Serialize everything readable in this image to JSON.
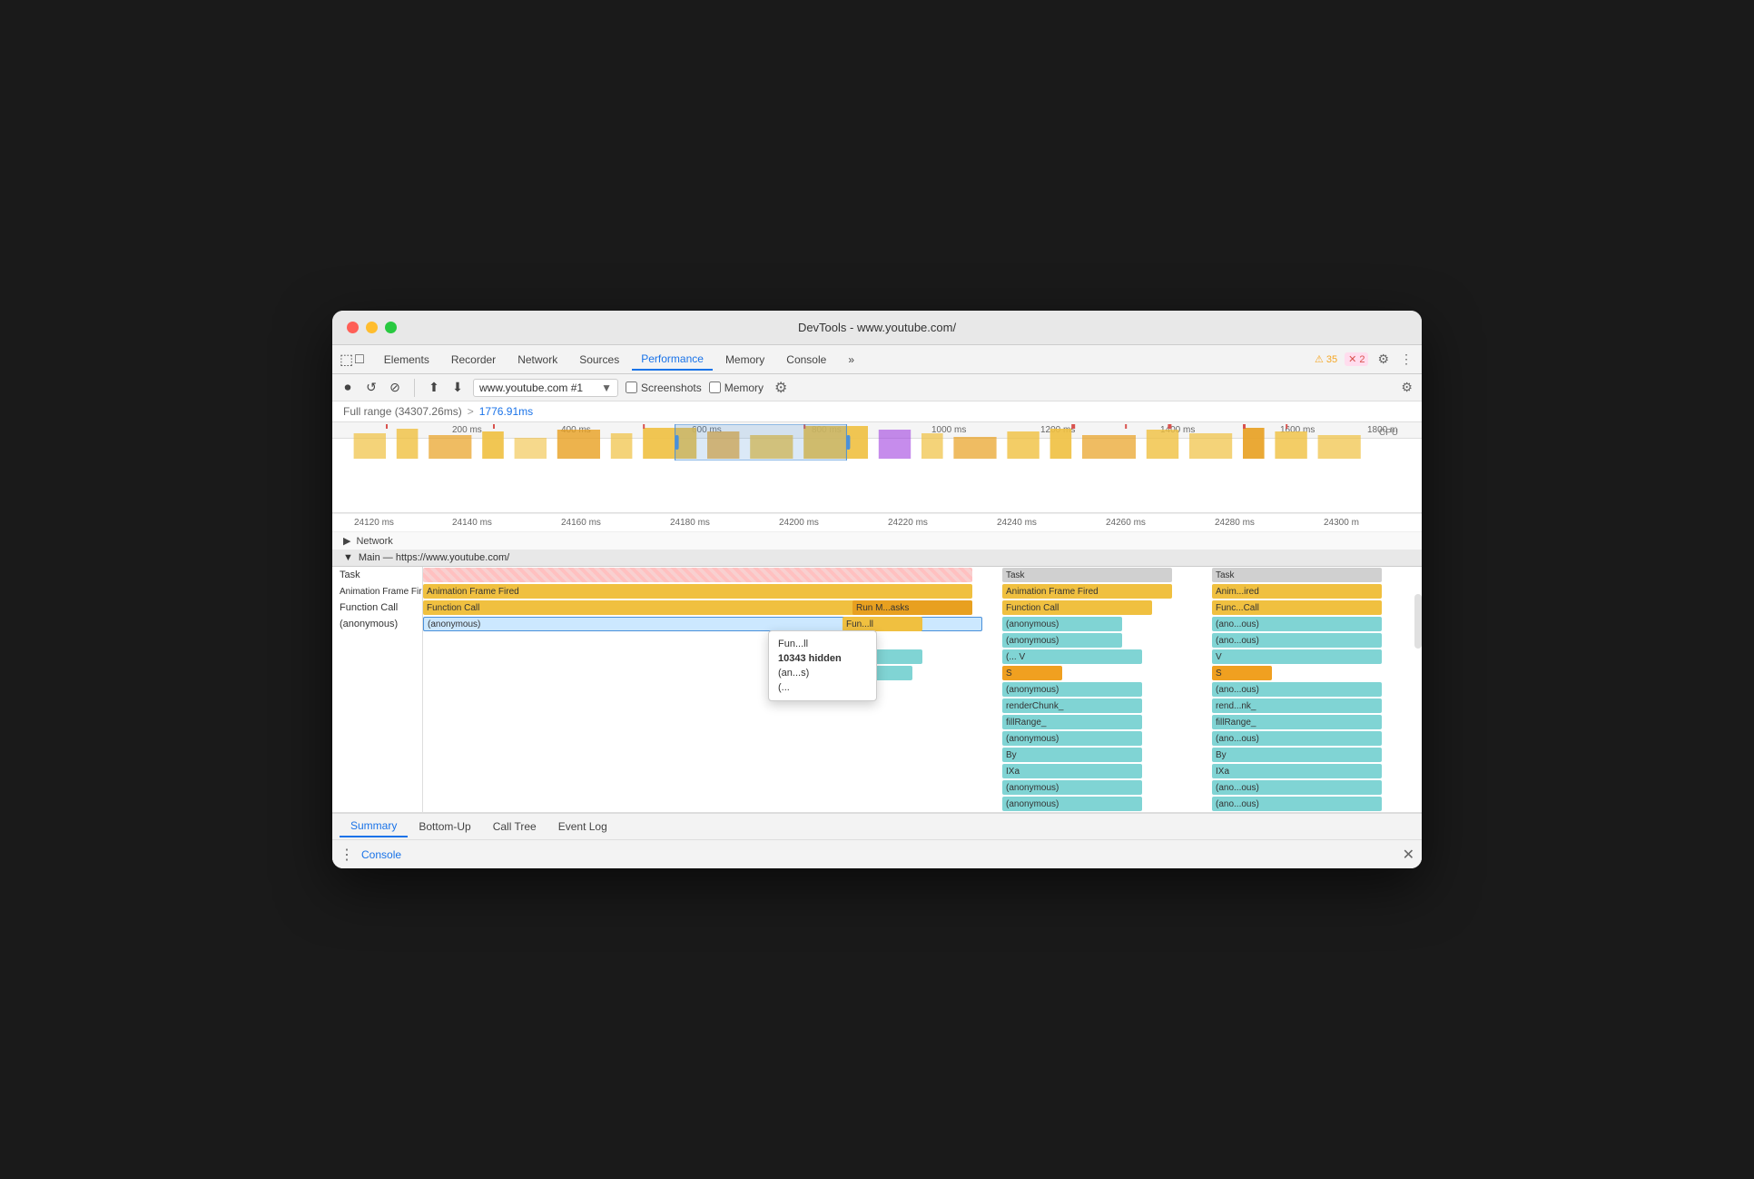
{
  "window": {
    "title": "DevTools - www.youtube.com/"
  },
  "tabs": [
    {
      "label": "Elements",
      "active": false
    },
    {
      "label": "Recorder",
      "active": false
    },
    {
      "label": "Network",
      "active": false
    },
    {
      "label": "Sources",
      "active": false
    },
    {
      "label": "Performance",
      "active": true
    },
    {
      "label": "Memory",
      "active": false
    },
    {
      "label": "Console",
      "active": false
    },
    {
      "label": "»",
      "active": false
    }
  ],
  "toolbar": {
    "record_label": "⏺",
    "reload_label": "↺",
    "clear_label": "⊘",
    "upload_label": "⬆",
    "download_label": "⬇",
    "url_value": "www.youtube.com #1",
    "screenshots_label": "Screenshots",
    "memory_label": "Memory",
    "settings_label": "⚙"
  },
  "warnings": {
    "warning_count": "35",
    "error_count": "2"
  },
  "breadcrumb": {
    "full_range": "Full range (34307.26ms)",
    "arrow": ">",
    "selected": "1776.91ms"
  },
  "ruler": {
    "ticks": [
      "24120 ms",
      "24140 ms",
      "24160 ms",
      "24180 ms",
      "24200 ms",
      "24220 ms",
      "24240 ms",
      "24260 ms",
      "24280 ms",
      "24300 m"
    ]
  },
  "timeline_top_ruler": {
    "ticks": [
      "200 ms",
      "400 ms",
      "600 ms",
      "800 ms",
      "1000 ms",
      "1200 ms",
      "1400 ms",
      "1600 ms",
      "1800 m"
    ]
  },
  "network_row": {
    "triangle": "▶",
    "label": "Network"
  },
  "main_section": {
    "header": "Main — https://www.youtube.com/"
  },
  "flame_rows": [
    {
      "label": "Task",
      "blocks": [
        {
          "text": "",
          "color": "color-task-gray",
          "left": "0%",
          "width": "58%",
          "striped": true
        },
        {
          "text": "Task",
          "color": "color-task-gray",
          "left": "60%",
          "width": "18%"
        },
        {
          "text": "Task",
          "color": "color-task-gray",
          "left": "82%",
          "width": "18%"
        }
      ]
    },
    {
      "label": "Animation Frame Fired",
      "blocks": [
        {
          "text": "Animation Frame Fired",
          "color": "color-yellow",
          "left": "0%",
          "width": "56%"
        },
        {
          "text": "Animation Frame Fired",
          "color": "color-yellow",
          "left": "60%",
          "width": "18%"
        },
        {
          "text": "Anim...ired",
          "color": "color-yellow",
          "left": "82%",
          "width": "17%"
        }
      ]
    },
    {
      "label": "Function Call",
      "blocks": [
        {
          "text": "Function Call",
          "color": "color-yellow",
          "left": "0%",
          "width": "56%"
        },
        {
          "text": "Run M...asks",
          "color": "color-orange",
          "left": "45%",
          "width": "11%"
        },
        {
          "text": "Function Call",
          "color": "color-yellow",
          "left": "60%",
          "width": "15%"
        },
        {
          "text": "Func...Call",
          "color": "color-yellow",
          "left": "82%",
          "width": "17%"
        }
      ]
    },
    {
      "label": "(anonymous)",
      "selected": true,
      "blocks": [
        {
          "text": "(anonymous)",
          "color": "color-cyan",
          "left": "0%",
          "width": "56%",
          "selected": true
        },
        {
          "text": "Fun...ll",
          "color": "color-yellow",
          "left": "44%",
          "width": "7%"
        },
        {
          "text": "(anonymous)",
          "color": "color-cyan",
          "left": "60%",
          "width": "10%"
        },
        {
          "text": "(ano...ous)",
          "color": "color-cyan",
          "left": "82%",
          "width": "17%"
        }
      ]
    },
    {
      "label": "",
      "blocks": [
        {
          "text": "(anonymous)",
          "color": "color-cyan",
          "left": "60%",
          "width": "10%"
        },
        {
          "text": "(ano...ous)",
          "color": "color-cyan",
          "left": "82%",
          "width": "17%"
        }
      ]
    },
    {
      "label": "",
      "blocks": [
        {
          "text": "(an...s)",
          "color": "color-cyan",
          "left": "44%",
          "width": "8%"
        },
        {
          "text": "(... V",
          "color": "color-cyan",
          "left": "60%",
          "width": "10%"
        },
        {
          "text": "V",
          "color": "color-cyan",
          "left": "82%",
          "width": "17%"
        }
      ]
    },
    {
      "label": "",
      "blocks": [
        {
          "text": "(...",
          "color": "color-cyan",
          "left": "44%",
          "width": "7%"
        },
        {
          "text": "S",
          "color": "color-orange",
          "left": "60%",
          "width": "10%"
        },
        {
          "text": "S",
          "color": "color-orange",
          "left": "82%",
          "width": "17%"
        }
      ]
    },
    {
      "label": "",
      "blocks": [
        {
          "text": "(anonymous)",
          "color": "color-cyan",
          "left": "60%",
          "width": "14%"
        },
        {
          "text": "(ano...ous)",
          "color": "color-cyan",
          "left": "82%",
          "width": "17%"
        }
      ]
    },
    {
      "label": "",
      "blocks": [
        {
          "text": "renderChunk_",
          "color": "color-cyan",
          "left": "60%",
          "width": "14%"
        },
        {
          "text": "rend...nk_",
          "color": "color-cyan",
          "left": "82%",
          "width": "17%"
        }
      ]
    },
    {
      "label": "",
      "blocks": [
        {
          "text": "fillRange_",
          "color": "color-cyan",
          "left": "60%",
          "width": "14%"
        },
        {
          "text": "fillRange_",
          "color": "color-cyan",
          "left": "82%",
          "width": "17%"
        }
      ]
    },
    {
      "label": "",
      "blocks": [
        {
          "text": "(anonymous)",
          "color": "color-cyan",
          "left": "60%",
          "width": "14%"
        },
        {
          "text": "(ano...ous)",
          "color": "color-cyan",
          "left": "82%",
          "width": "17%"
        }
      ]
    },
    {
      "label": "",
      "blocks": [
        {
          "text": "By",
          "color": "color-cyan",
          "left": "60%",
          "width": "14%"
        },
        {
          "text": "By",
          "color": "color-cyan",
          "left": "82%",
          "width": "17%"
        }
      ]
    },
    {
      "label": "",
      "blocks": [
        {
          "text": "IXa",
          "color": "color-cyan",
          "left": "60%",
          "width": "14%"
        },
        {
          "text": "IXa",
          "color": "color-cyan",
          "left": "82%",
          "width": "17%"
        }
      ]
    },
    {
      "label": "",
      "blocks": [
        {
          "text": "(anonymous)",
          "color": "color-cyan",
          "left": "60%",
          "width": "14%"
        },
        {
          "text": "(ano...ous)",
          "color": "color-cyan",
          "left": "82%",
          "width": "17%"
        }
      ]
    },
    {
      "label": "",
      "blocks": [
        {
          "text": "(anonymous)",
          "color": "color-cyan",
          "left": "60%",
          "width": "14%"
        },
        {
          "text": "(ano...ous)",
          "color": "color-cyan",
          "left": "82%",
          "width": "17%"
        }
      ]
    }
  ],
  "tooltip": {
    "line1": "Fun...ll",
    "line2": "10343 hidden",
    "line3": "(an...s)",
    "line4": "(...",
    "visible": true
  },
  "bottom_tabs": [
    {
      "label": "Summary",
      "active": true
    },
    {
      "label": "Bottom-Up",
      "active": false
    },
    {
      "label": "Call Tree",
      "active": false
    },
    {
      "label": "Event Log",
      "active": false
    }
  ],
  "console_bar": {
    "dots": "⋮",
    "label": "Console",
    "close": "✕"
  }
}
